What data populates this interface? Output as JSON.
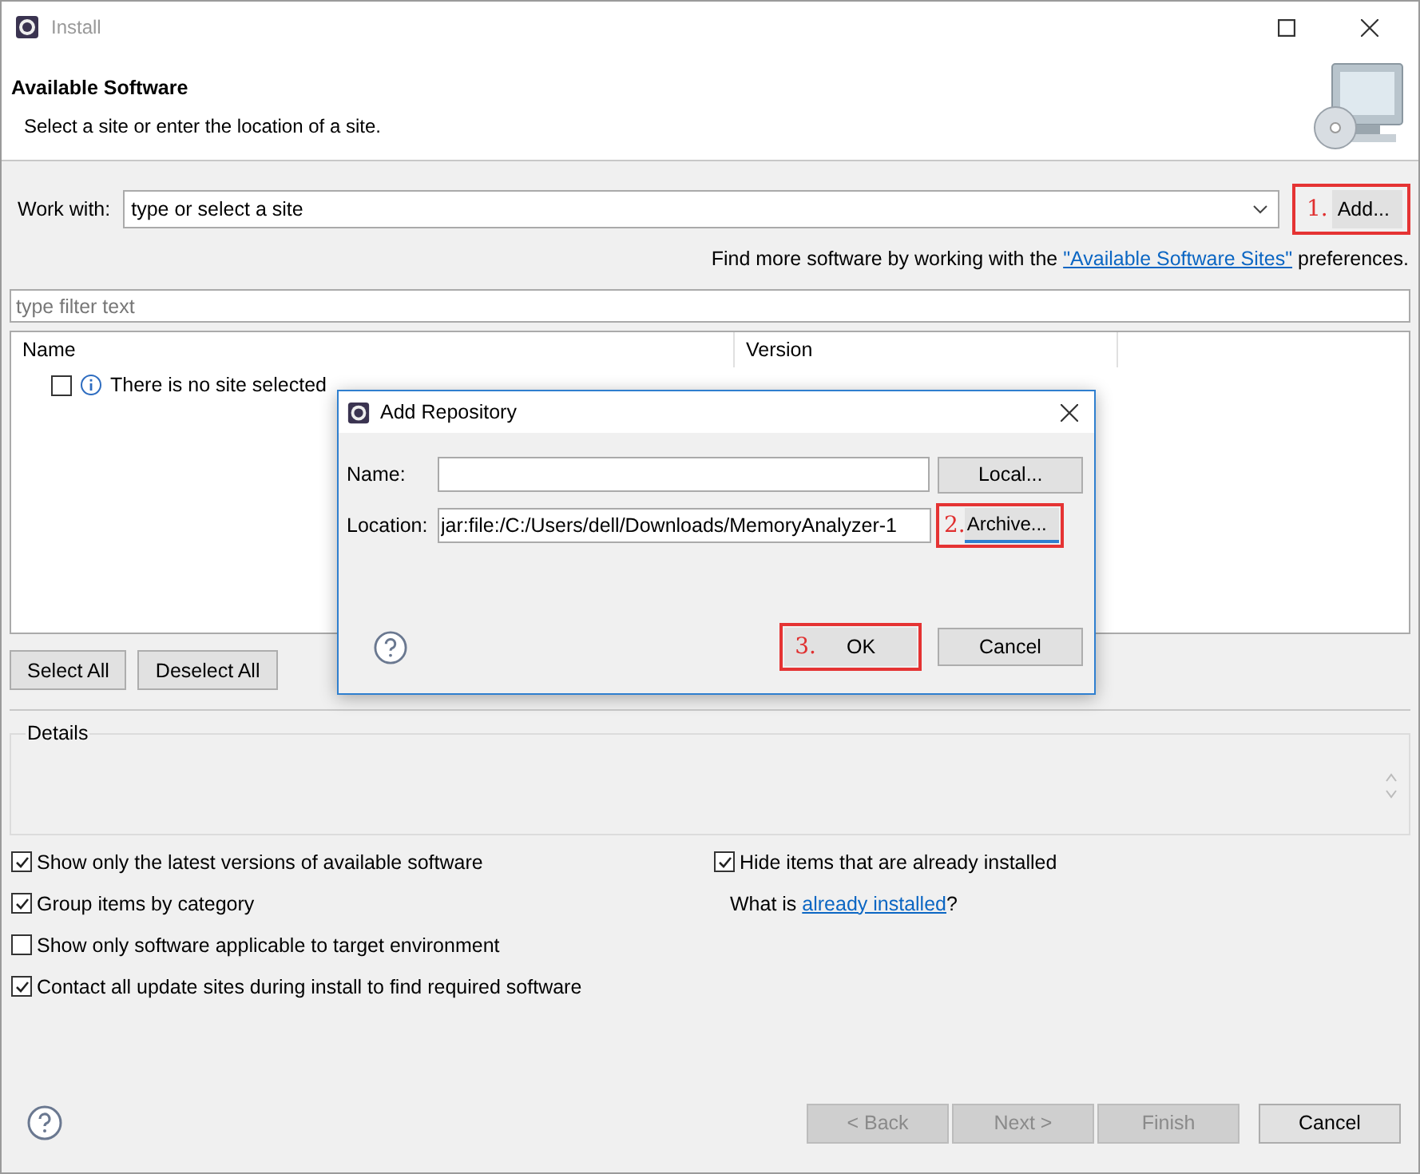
{
  "window": {
    "title": "Install"
  },
  "header": {
    "title": "Available Software",
    "subtitle": "Select a site or enter the location of a site."
  },
  "work_with": {
    "label": "Work with:",
    "value": "type or select a site",
    "button": {
      "step": "1.",
      "label": "Add..."
    }
  },
  "sites_hint": {
    "before": "Find more software by working with the",
    "link": "\"Available Software Sites\"",
    "after": "preferences."
  },
  "filter": {
    "placeholder": "type filter text"
  },
  "table": {
    "columns": [
      "Name",
      "Version"
    ],
    "rows": [
      {
        "checked": false,
        "text": "There is no site selected"
      }
    ]
  },
  "selection_buttons": [
    "Select All",
    "Deselect All"
  ],
  "details": {
    "label": "Details"
  },
  "options": [
    {
      "label": "Show only the latest versions of available software",
      "checked": true
    },
    {
      "label": "Group items by category",
      "checked": true
    },
    {
      "label": "Show only software applicable to target environment",
      "checked": false
    },
    {
      "label": "Contact all update sites during install to find required software",
      "checked": true
    }
  ],
  "side_options": [
    {
      "label": "Hide items that are already installed",
      "checked": true
    }
  ],
  "installed_note": {
    "before": "What is",
    "link": "already installed",
    "after": "?"
  },
  "footer_buttons": [
    {
      "label": "< Back",
      "disabled": true
    },
    {
      "label": "Next >",
      "disabled": true
    },
    {
      "label": "Finish",
      "disabled": true
    },
    {
      "label": "Cancel",
      "disabled": false
    }
  ],
  "dialog": {
    "title": "Add Repository",
    "name_label": "Name:",
    "location_label": "Location:",
    "location_value": "jar:file:/C:/Users/dell/Downloads/MemoryAnalyzer-1",
    "local_button": "Local...",
    "archive_button": {
      "step": "2.",
      "label": "Archive..."
    },
    "ok_button": {
      "step": "3.",
      "label": "OK"
    },
    "cancel_button": "Cancel"
  }
}
